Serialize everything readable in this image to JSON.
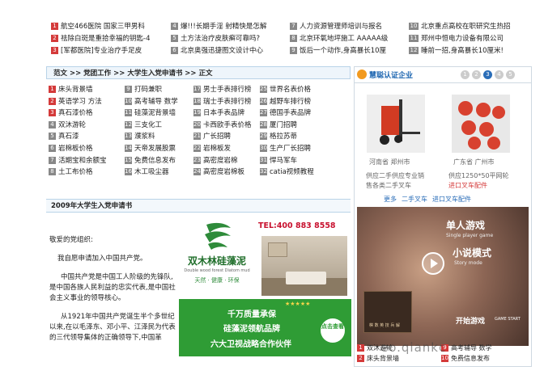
{
  "top_news": {
    "col1": [
      {
        "n": "1",
        "text": "航空466医院 国家三甲男科"
      },
      {
        "n": "2",
        "text": "祛除白斑是重拾幸福的钥匙-4"
      },
      {
        "n": "3",
        "text": "[军都医院]专业治疗手足皮"
      }
    ],
    "col2": [
      {
        "n": "4",
        "text": "爆!!!长期手淫 射精快是怎解"
      },
      {
        "n": "5",
        "text": "土方法治疗皮肤癣可靠吗?"
      },
      {
        "n": "6",
        "text": "北京奥强迅捷图文设计中心"
      }
    ],
    "col3": [
      {
        "n": "7",
        "text": "人力资源管理师培训与报名"
      },
      {
        "n": "8",
        "text": "北京环氧地坪施工 AAAAA级"
      },
      {
        "n": "9",
        "text": "饭后一个动作,身高暴长10厘"
      }
    ],
    "col4": [
      {
        "n": "10",
        "text": "北京重点高校在职研究生热招"
      },
      {
        "n": "11",
        "text": "郑州中恒电力设备有限公司"
      },
      {
        "n": "12",
        "text": "睡前一招,身高暴长10厘米!"
      }
    ]
  },
  "breadcrumb": "范文 >> 党团工作 >> 大学生入党申请书 >> 正文",
  "link_grid": [
    [
      {
        "n": "1",
        "t": "床头背景墙"
      },
      {
        "n": "9",
        "t": "打码兼职"
      },
      {
        "n": "17",
        "t": "男士手表排行榜"
      },
      {
        "n": "25",
        "t": "世界名表价格"
      }
    ],
    [
      {
        "n": "2",
        "t": "英语学习 方法"
      },
      {
        "n": "10",
        "t": "高考辅导 数学"
      },
      {
        "n": "18",
        "t": "瑞士手表排行榜"
      },
      {
        "n": "26",
        "t": "越野车排行榜"
      }
    ],
    [
      {
        "n": "3",
        "t": "真石漆价格"
      },
      {
        "n": "11",
        "t": "硅藻泥背景墙"
      },
      {
        "n": "19",
        "t": "日本手表品牌"
      },
      {
        "n": "27",
        "t": "德国手表品牌"
      }
    ],
    [
      {
        "n": "4",
        "t": "双沐游轮"
      },
      {
        "n": "12",
        "t": "三支化工"
      },
      {
        "n": "20",
        "t": "卡西欧手表价格"
      },
      {
        "n": "28",
        "t": "厦门招聘"
      }
    ],
    [
      {
        "n": "5",
        "t": "真石漆"
      },
      {
        "n": "13",
        "t": "濮浆料"
      },
      {
        "n": "21",
        "t": "广长招聘"
      },
      {
        "n": "29",
        "t": "格拉苏蒂"
      }
    ],
    [
      {
        "n": "6",
        "t": "岩棉板价格"
      },
      {
        "n": "14",
        "t": "天帝发展股票"
      },
      {
        "n": "22",
        "t": "岩棉板发"
      },
      {
        "n": "30",
        "t": "生产厂长招聘"
      }
    ],
    [
      {
        "n": "7",
        "t": "活期宝和余额宝"
      },
      {
        "n": "15",
        "t": "免费信息发布"
      },
      {
        "n": "23",
        "t": "高密度岩棉"
      },
      {
        "n": "31",
        "t": "悍马军车"
      }
    ],
    [
      {
        "n": "8",
        "t": "土工布价格"
      },
      {
        "n": "16",
        "t": "木工吸尘器"
      },
      {
        "n": "24",
        "t": "高密度岩棉板"
      },
      {
        "n": "32",
        "t": "catia视频教程"
      }
    ]
  ],
  "section_title": "2009年大学生入党申请书",
  "article": {
    "greeting": "敬爱的党组织:",
    "p1": "我自愿申请加入中国共产党。",
    "p2": "中国共产党是中国工人阶级的先锋队,是中国各族人民利益的忠实代表,是中国社会主义事业的领导核心。",
    "p3": "从1921年中国共产党诞生半个多世纪以来,在以毛泽东、邓小平、江泽民为代表的三代领导集体的正确领导下,中国革"
  },
  "ad": {
    "tel": "TEL:400 883 8558",
    "brand": "双木林硅藻泥",
    "brand_sub": "Double wood forest Diatom mud",
    "tagline": "天然 · 健康 · 环保",
    "line1": "千万质量承保",
    "line2": "硅藻泥领航品牌",
    "line3": "六大卫视战略合作伙伴",
    "button": "点击查看",
    "stars": "★★★★★"
  },
  "right": {
    "logo": "慧聪认证企业",
    "pages": [
      "1",
      "2",
      "3",
      "4",
      "5"
    ],
    "active_page": "3",
    "products": [
      {
        "loc": "河南省 郑州市",
        "desc1": "供应二手供应专业销",
        "desc2": "售各类二手叉车"
      },
      {
        "loc": "广东省 广州市",
        "desc1": "供应1250*50平网轮",
        "desc2": "进口叉车配件"
      }
    ],
    "links": [
      "更多",
      "二手叉车",
      "进口叉车配件"
    ],
    "game": {
      "title1": "单人游戏",
      "title1_en": "Single player game",
      "title2": "小说模式",
      "title2_en": "Story mode",
      "start": "开始游戏",
      "start_en": "GAME START",
      "book": "棋 数 英 技 兵 解"
    },
    "bottom": [
      {
        "n": "1",
        "t": "双沐游轮",
        "n2": "9",
        "t2": "高考辅导 数学"
      },
      {
        "n": "2",
        "t": "床头背景墙",
        "n2": "10",
        "t2": "免费信息发布"
      }
    ]
  },
  "watermark": "eo.qiankc"
}
